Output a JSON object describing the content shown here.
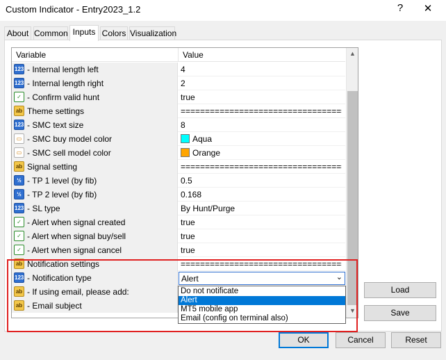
{
  "window": {
    "title": "Custom Indicator - Entry2023_1.2",
    "help_label": "?",
    "close_label": "✕"
  },
  "tabs": [
    {
      "label": "About"
    },
    {
      "label": "Common"
    },
    {
      "label": "Inputs"
    },
    {
      "label": "Colors"
    },
    {
      "label": "Visualization"
    }
  ],
  "active_tab": "Inputs",
  "grid": {
    "headers": {
      "variable": "Variable",
      "value": "Value"
    },
    "rows": [
      {
        "icon": "123",
        "type": "num",
        "name": "- Internal length left",
        "value": "4"
      },
      {
        "icon": "123",
        "type": "num",
        "name": "- Internal length right",
        "value": "2"
      },
      {
        "icon": "✓",
        "type": "bool",
        "name": "- Confirm valid hunt",
        "value": "true"
      },
      {
        "icon": "ab",
        "type": "ab",
        "name": "Theme settings",
        "value": "=========================================..."
      },
      {
        "icon": "123",
        "type": "num",
        "name": "- SMC text size",
        "value": "8"
      },
      {
        "icon": "▭",
        "type": "color",
        "name": "- SMC buy model color",
        "value": "Aqua",
        "swatch": "#00ffff"
      },
      {
        "icon": "▭",
        "type": "color",
        "name": "- SMC sell model color",
        "value": "Orange",
        "swatch": "#ffa500"
      },
      {
        "icon": "ab",
        "type": "ab",
        "name": "Signal setting",
        "value": "=========================================..."
      },
      {
        "icon": "½",
        "type": "frac",
        "name": "- TP 1 level (by fib)",
        "value": "0.5"
      },
      {
        "icon": "½",
        "type": "frac",
        "name": "- TP 2 level (by fib)",
        "value": "0.168"
      },
      {
        "icon": "123",
        "type": "num",
        "name": "- SL type",
        "value": "By Hunt/Purge"
      },
      {
        "icon": "✓",
        "type": "bool",
        "name": "- Alert when signal created",
        "value": "true"
      },
      {
        "icon": "✓",
        "type": "bool",
        "name": "- Alert when signal buy/sell",
        "value": "true"
      },
      {
        "icon": "✓",
        "type": "bool",
        "name": "- Alert when signal cancel",
        "value": "true"
      },
      {
        "icon": "ab",
        "type": "ab",
        "name": "Notification settings",
        "value": "=========================================..."
      },
      {
        "icon": "123",
        "type": "num",
        "name": "- Notification type",
        "value": "Alert",
        "combo": true
      },
      {
        "icon": "ab",
        "type": "ab",
        "name": "- If using email, please add:",
        "value": ""
      },
      {
        "icon": "ab",
        "type": "ab",
        "name": "- Email subject",
        "value": ""
      }
    ]
  },
  "dropdown": {
    "options": [
      "Do not notificate",
      "Alert",
      "MT5 mobile app",
      "Email (config on terminal also)"
    ],
    "selected_index": 1
  },
  "side_buttons": {
    "load": "Load",
    "save": "Save"
  },
  "footer_buttons": {
    "ok": "OK",
    "cancel": "Cancel",
    "reset": "Reset"
  },
  "colors": {
    "highlight": "#e02020",
    "selection": "#0078d7"
  }
}
